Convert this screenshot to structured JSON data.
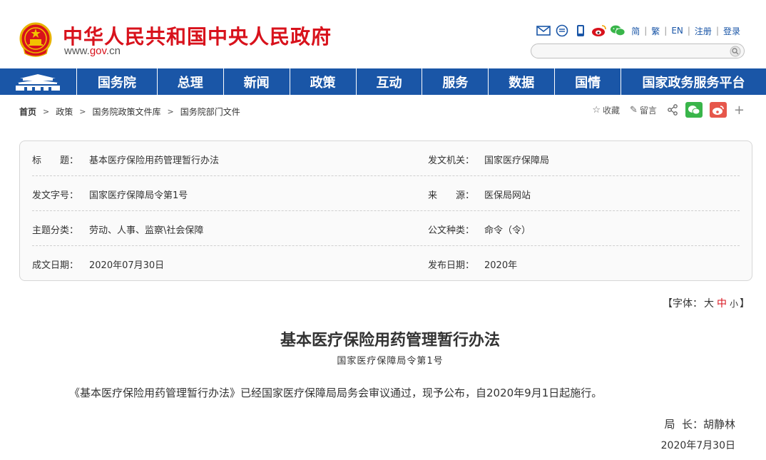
{
  "header": {
    "site_title": "中华人民共和国中央人民政府",
    "domain_prefix": "www.",
    "domain_main": "gov",
    "domain_suffix": ".cn",
    "links": [
      "简",
      "繁",
      "EN",
      "注册",
      "登录"
    ],
    "icons": [
      "mail-icon",
      "message-icon",
      "mobile-icon",
      "weibo-icon",
      "wechat-icon"
    ],
    "search_placeholder": ""
  },
  "nav": {
    "items": [
      "国务院",
      "总理",
      "新闻",
      "政策",
      "互动",
      "服务",
      "数据",
      "国情",
      "国家政务服务平台"
    ]
  },
  "breadcrumb": {
    "items": [
      "首页",
      "政策",
      "国务院政策文件库",
      "国务院部门文件"
    ]
  },
  "tools": {
    "favorite": "收藏",
    "comment": "留言"
  },
  "info": {
    "rows": [
      {
        "l1": "标　　题：",
        "v1": "基本医疗保险用药管理暂行办法",
        "l2": "发文机关：",
        "v2": "国家医疗保障局"
      },
      {
        "l1": "发文字号：",
        "v1": "国家医疗保障局令第1号",
        "l2": "来　　源：",
        "v2": "医保局网站"
      },
      {
        "l1": "主题分类：",
        "v1": "劳动、人事、监察\\社会保障",
        "l2": "公文种类：",
        "v2": "命令（令）"
      },
      {
        "l1": "成文日期：",
        "v1": "2020年07月30日",
        "l2": "发布日期：",
        "v2": "2020年"
      }
    ]
  },
  "font_size": {
    "prefix": "【字体：",
    "large": "大",
    "medium": "中",
    "small": "小",
    "suffix": "】"
  },
  "article": {
    "title": "基本医疗保险用药管理暂行办法",
    "subtitle": "国家医疗保障局令第1号",
    "body": "《基本医疗保险用药管理暂行办法》已经国家医疗保障局局务会审议通过，现予公布，自2020年9月1日起施行。",
    "signature": "局  长：胡静林",
    "date": "2020年7月30日"
  },
  "colors": {
    "brand_red": "#d8121c",
    "nav_blue": "#1a56a7",
    "wechat_green": "#39b54a",
    "weibo_red": "#e6574b"
  }
}
